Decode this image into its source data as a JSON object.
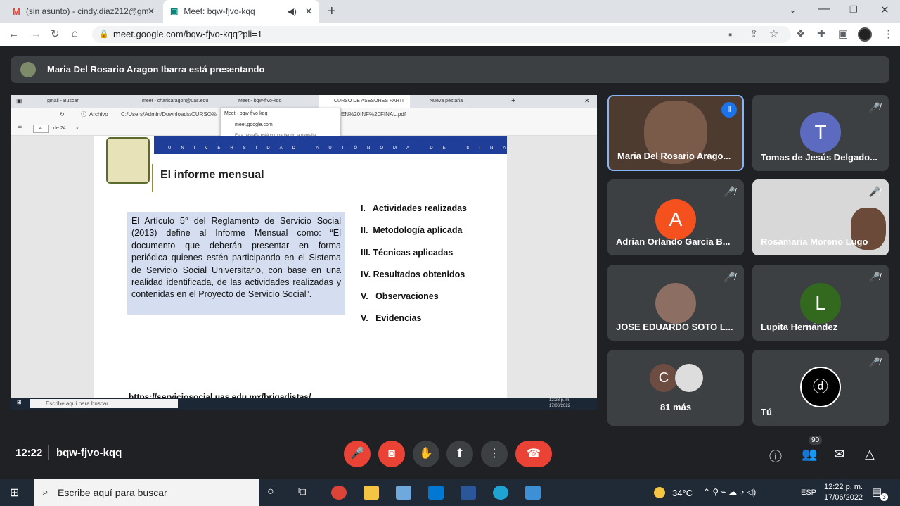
{
  "browser": {
    "tabs": [
      {
        "title": "(sin asunto) - cindy.diaz212@gm",
        "icon": "gmail-icon"
      },
      {
        "title": "Meet: bqw-fjvo-kqq",
        "icon": "meet-icon"
      }
    ],
    "url": "meet.google.com/bqw-fjvo-kqq?pli=1"
  },
  "presenter_banner": "Maria Del Rosario Aragon Ibarra está presentando",
  "shared": {
    "tabs": [
      "gmail - Buscar",
      "meet - charisaragon@uas.edu",
      "Meet - bqw-fjvo-kqq",
      "CURSO DE ASESORES PARTI",
      "Nueva pestaña"
    ],
    "archive_label": "Archivo",
    "path": "C:/Users/Admin/Downloads/CURSO%",
    "path_end": "EN%20INF%20FINAL.pdf",
    "page_num": "4",
    "page_total": "de 24",
    "tooltip": {
      "title": "Meet - bqw-fjvo-kqq",
      "site": "meet.google.com",
      "note": "Esta pestaña está compartiendo la pantalla."
    },
    "university": "UNIVERSIDAD AUTÓNOMA DE SINALOA",
    "slide_title": "El informe mensual",
    "paragraph": "El Artículo 5° del Reglamento de Servicio Social (2013) define al Informe Mensual como: “El documento que deberán presentar en forma periódica quienes estén participando en el Sistema de Servicio Social Universitario, con base en una realidad identificada, de las actividades realizadas y contenidas en el Proyecto de Servicio Social”.",
    "list": [
      "I.   Actividades realizadas",
      "II.  Metodología aplicada",
      "III. Técnicas aplicadas",
      "IV. Resultados obtenidos",
      "V.   Observaciones",
      "V.   Evidencias"
    ],
    "link": "https://serviciosocial.uas.edu.mx/brigadistas/",
    "taskbar_search": "Escribe aquí para buscar.",
    "time": "12:23 p. m.",
    "date": "17/06/2022"
  },
  "participants": [
    {
      "name": "Maria Del Rosario Arago...",
      "initial": "",
      "color": "#5d4037",
      "muted": false
    },
    {
      "name": "Tomas de Jesús Delgado...",
      "initial": "T",
      "color": "#5c6bc0",
      "muted": true
    },
    {
      "name": "Adrian Orlando Garcia B...",
      "initial": "A",
      "color": "#f4511e",
      "muted": true
    },
    {
      "name": "Rosamaria Moreno Lugo",
      "initial": "",
      "color": "#8d6e63",
      "muted": true
    },
    {
      "name": "JOSE EDUARDO SOTO L...",
      "initial": "",
      "color": "#6d4c41",
      "muted": true
    },
    {
      "name": "Lupita Hernández",
      "initial": "L",
      "color": "#33691e",
      "muted": true
    },
    {
      "name": "81 más",
      "initial": "C",
      "color": "#6d4c41",
      "muted": false
    },
    {
      "name": "Tú",
      "initial": "",
      "color": "#000000",
      "muted": true
    }
  ],
  "meeting": {
    "time": "12:22",
    "code": "bqw-fjvo-kqq",
    "participant_count": "90",
    "activities_count": "3"
  },
  "taskbar": {
    "search": "Escribe aquí para buscar",
    "temp": "34°C",
    "lang": "ESP",
    "time": "12:22 p. m.",
    "date": "17/06/2022",
    "notif": "3"
  }
}
